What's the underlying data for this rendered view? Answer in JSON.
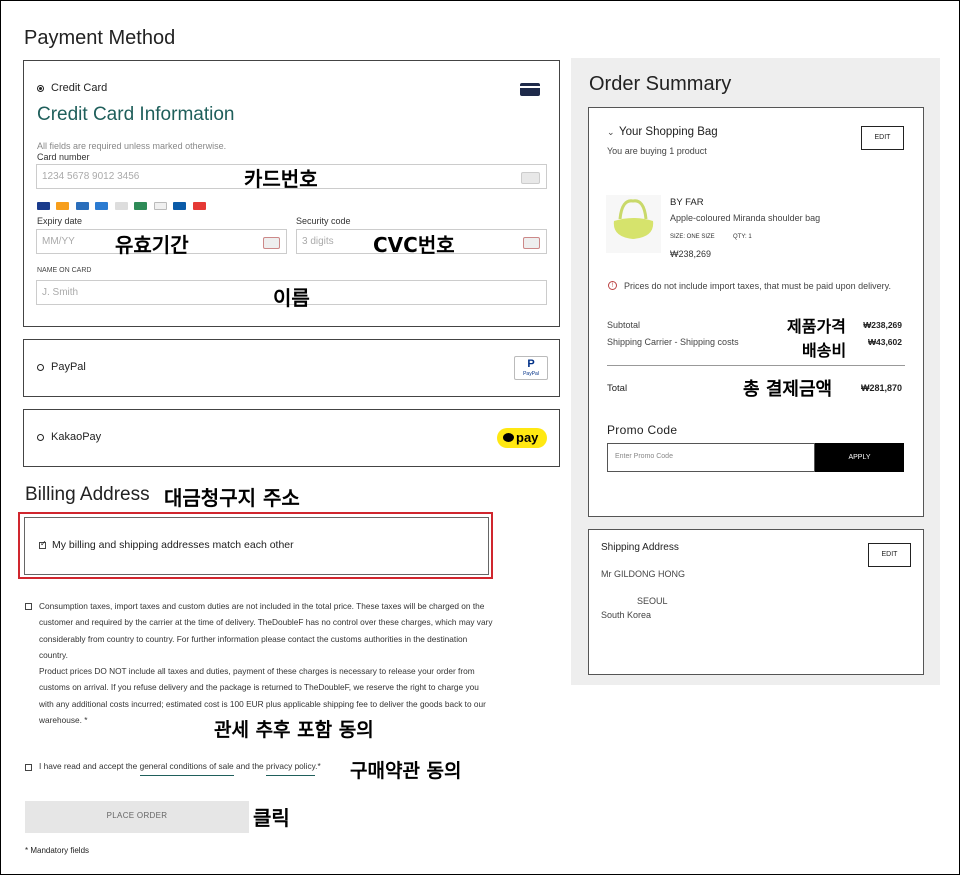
{
  "payment": {
    "title": "Payment Method",
    "credit_card": {
      "label": "Credit Card",
      "heading": "Credit Card Information",
      "required_note": "All fields are required unless marked otherwise.",
      "card_number_label": "Card number",
      "card_number_placeholder": "1234 5678 9012 3456",
      "expiry_label": "Expiry date",
      "expiry_placeholder": "MM/YY",
      "security_label": "Security code",
      "security_placeholder": "3 digits",
      "name_label": "NAME ON CARD",
      "name_placeholder": "J. Smith"
    },
    "paypal": {
      "label": "PayPal",
      "logo_text": "PayPal"
    },
    "kakaopay": {
      "label": "KakaoPay",
      "logo_text": "pay"
    }
  },
  "billing": {
    "title": "Billing Address",
    "match_label": "My billing and shipping addresses match each other"
  },
  "legal": {
    "taxes_text_1": "Consumption taxes, import taxes and custom duties are not included in the total price. These taxes will be charged on the customer and required by the carrier at the time of delivery. TheDoubleF has no control over these charges, which may vary considerably from country to country. For further information please contact the customs authorities in the destination country.",
    "taxes_text_2": "Product prices DO NOT include all taxes and duties, payment of these charges is necessary to release your order from customs on arrival. If you refuse delivery and the package is returned to TheDoubleF, we reserve the right to charge you with any additional costs incurred; estimated cost is 100 EUR plus applicable shipping fee to deliver the goods back to our warehouse. *",
    "terms_prefix": "I have read and accept the",
    "terms_link": "general conditions of sale",
    "terms_and": "and the",
    "privacy_link": "privacy policy",
    "terms_suffix": ".*"
  },
  "place_order": {
    "label": "PLACE ORDER"
  },
  "mandatory_note": "* Mandatory fields",
  "summary": {
    "title": "Order Summary",
    "bag_title": "Your Shopping Bag",
    "bag_subtitle": "You are buying 1 product",
    "edit_label": "EDIT",
    "product": {
      "brand": "BY FAR",
      "name": "Apple-coloured Miranda shoulder bag",
      "size": "SIZE: ONE SIZE",
      "qty": "QTY: 1",
      "price": "₩238,269"
    },
    "tax_notice": "Prices do not include import taxes, that must be paid upon delivery.",
    "subtotal_label": "Subtotal",
    "subtotal_value": "₩238,269",
    "shipping_label": "Shipping Carrier - Shipping costs",
    "shipping_value": "₩43,602",
    "total_label": "Total",
    "total_value": "₩281,870",
    "promo_title": "Promo Code",
    "promo_placeholder": "Enter Promo Code",
    "apply_label": "APPLY"
  },
  "shipping": {
    "title": "Shipping Address",
    "edit_label": "EDIT",
    "name": "Mr GILDONG HONG",
    "city": "SEOUL",
    "country": "South Korea"
  },
  "annotations": {
    "card_number": "카드번호",
    "expiry": "유효기간",
    "cvc": "CVC번호",
    "name": "이름",
    "billing": "대금청구지 주소",
    "product_price": "제품가격",
    "shipping_fee": "배송비",
    "total": "총 결제금액",
    "customs": "관세 추후 포함 동의",
    "terms": "구매약관 동의",
    "click": "클릭"
  },
  "colors": {
    "heading_teal": "#1f5f5b",
    "highlight_red": "#d0262e",
    "kakao_yellow": "#ffe812"
  }
}
